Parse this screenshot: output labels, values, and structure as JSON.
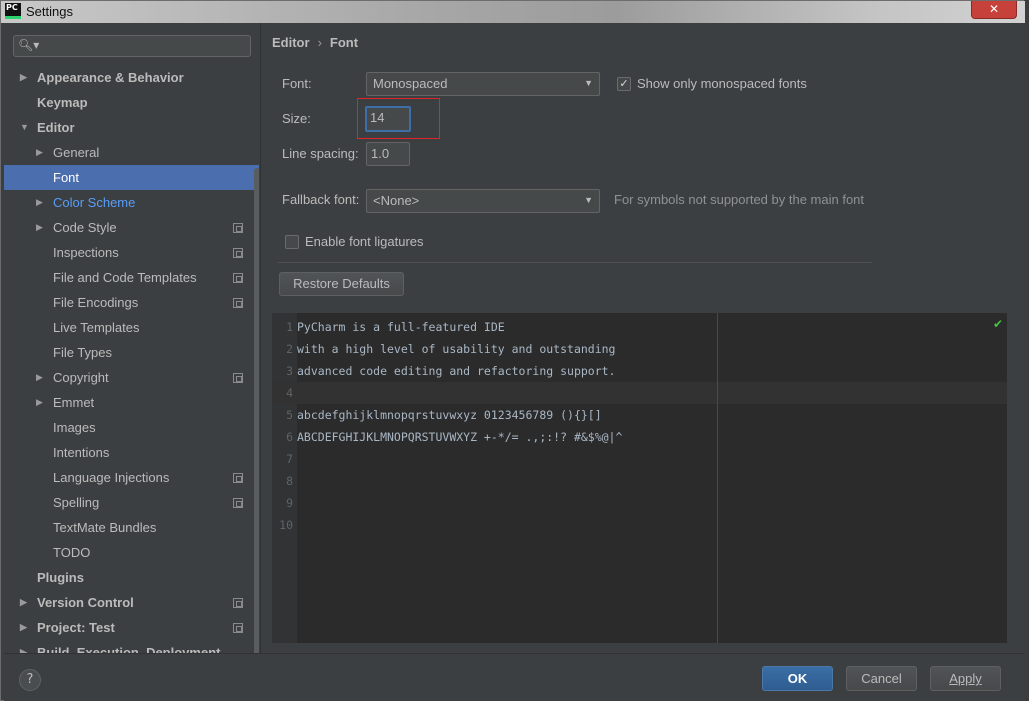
{
  "window": {
    "title": "Settings",
    "app_icon": "PC",
    "close_glyph": "✕"
  },
  "search": {
    "placeholder": ""
  },
  "tree": [
    {
      "label": "Appearance & Behavior",
      "level": 0,
      "bold": true,
      "arrow": "▶"
    },
    {
      "label": "Keymap",
      "level": 0,
      "bold": true,
      "arrow": ""
    },
    {
      "label": "Editor",
      "level": 0,
      "bold": true,
      "arrow": "▼"
    },
    {
      "label": "General",
      "level": 1,
      "arrow": "▶"
    },
    {
      "label": "Font",
      "level": 1,
      "arrow": "",
      "selected": true
    },
    {
      "label": "Color Scheme",
      "level": 1,
      "arrow": "▶",
      "link": true
    },
    {
      "label": "Code Style",
      "level": 1,
      "arrow": "▶",
      "copy": true
    },
    {
      "label": "Inspections",
      "level": 1,
      "arrow": "",
      "copy": true
    },
    {
      "label": "File and Code Templates",
      "level": 1,
      "arrow": "",
      "copy": true
    },
    {
      "label": "File Encodings",
      "level": 1,
      "arrow": "",
      "copy": true
    },
    {
      "label": "Live Templates",
      "level": 1,
      "arrow": ""
    },
    {
      "label": "File Types",
      "level": 1,
      "arrow": ""
    },
    {
      "label": "Copyright",
      "level": 1,
      "arrow": "▶",
      "copy": true
    },
    {
      "label": "Emmet",
      "level": 1,
      "arrow": "▶"
    },
    {
      "label": "Images",
      "level": 1,
      "arrow": ""
    },
    {
      "label": "Intentions",
      "level": 1,
      "arrow": ""
    },
    {
      "label": "Language Injections",
      "level": 1,
      "arrow": "",
      "copy": true
    },
    {
      "label": "Spelling",
      "level": 1,
      "arrow": "",
      "copy": true
    },
    {
      "label": "TextMate Bundles",
      "level": 1,
      "arrow": ""
    },
    {
      "label": "TODO",
      "level": 1,
      "arrow": ""
    },
    {
      "label": "Plugins",
      "level": 0,
      "bold": true,
      "arrow": ""
    },
    {
      "label": "Version Control",
      "level": 0,
      "bold": true,
      "arrow": "▶",
      "copy": true
    },
    {
      "label": "Project: Test",
      "level": 0,
      "bold": true,
      "arrow": "▶",
      "copy": true
    },
    {
      "label": "Build, Execution, Deployment",
      "level": 0,
      "bold": true,
      "arrow": "▶"
    }
  ],
  "breadcrumb": {
    "parent": "Editor",
    "separator": "›",
    "current": "Font"
  },
  "font_settings": {
    "font_label": "Font:",
    "font_value": "Monospaced",
    "show_monospaced_label": "Show only monospaced fonts",
    "show_monospaced_checked": true,
    "size_label": "Size:",
    "size_value": "14",
    "line_spacing_label": "Line spacing:",
    "line_spacing_value": "1.0",
    "fallback_label": "Fallback font:",
    "fallback_value": "<None>",
    "fallback_hint": "For symbols not supported by the main font",
    "ligatures_label": "Enable font ligatures",
    "ligatures_checked": false,
    "restore_label": "Restore Defaults"
  },
  "preview": {
    "lines": [
      {
        "num": "1",
        "text": "PyCharm is a full-featured IDE"
      },
      {
        "num": "2",
        "text": "with a high level of usability and outstanding"
      },
      {
        "num": "3",
        "text": "advanced code editing and refactoring support."
      },
      {
        "num": "4",
        "text": ""
      },
      {
        "num": "5",
        "text": "abcdefghijklmnopqrstuvwxyz 0123456789 (){}[]"
      },
      {
        "num": "6",
        "text": "ABCDEFGHIJKLMNOPQRSTUVWXYZ +-*/= .,;:!? #&$%@|^"
      },
      {
        "num": "7",
        "text": ""
      },
      {
        "num": "8",
        "text": ""
      },
      {
        "num": "9",
        "text": ""
      },
      {
        "num": "10",
        "text": ""
      }
    ],
    "current_line": 4
  },
  "footer": {
    "help": "?",
    "ok": "OK",
    "cancel": "Cancel",
    "apply": "Apply"
  },
  "colors": {
    "background": "#3c3f41",
    "selection": "#4b6eaf",
    "link": "#589df6",
    "highlight_border": "#e0242a",
    "editor_bg": "#2b2b2b"
  }
}
